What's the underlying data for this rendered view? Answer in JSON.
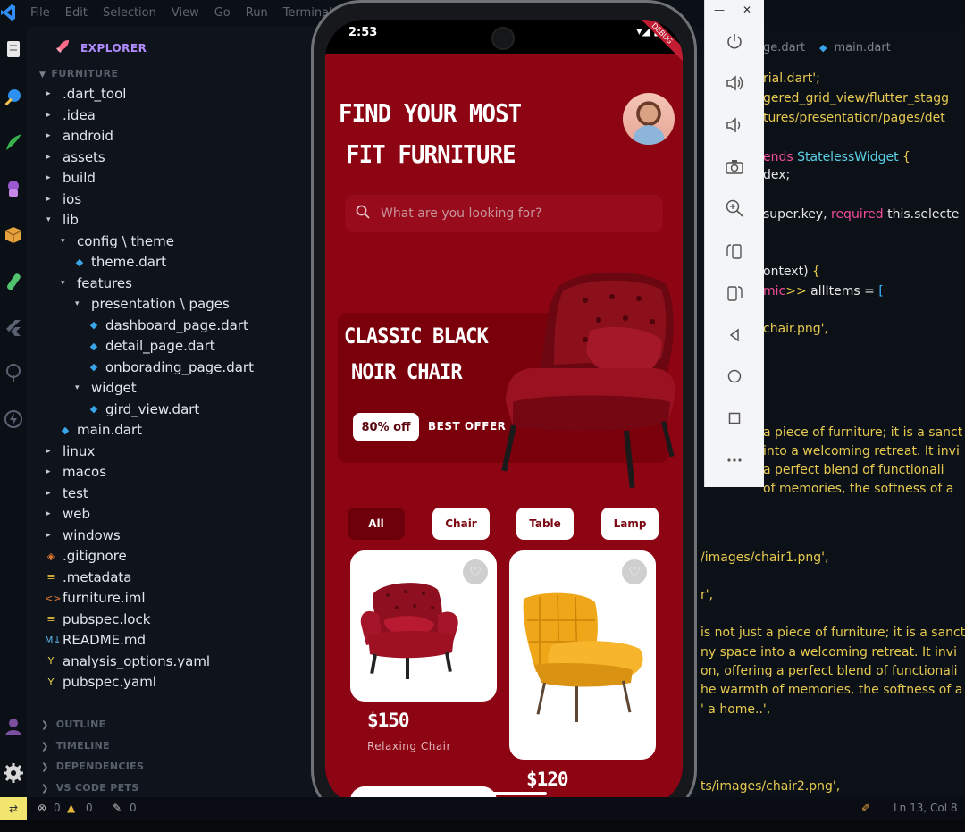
{
  "vscode": {
    "menu": [
      "File",
      "Edit",
      "Selection",
      "View",
      "Go",
      "Run",
      "Terminal"
    ],
    "explorer_title": "EXPLORER",
    "project": "FURNITURE",
    "tree": [
      {
        "label": ".dart_tool",
        "type": "folder-closed",
        "depth": 1
      },
      {
        "label": ".idea",
        "type": "folder-closed",
        "depth": 1
      },
      {
        "label": "android",
        "type": "folder-closed",
        "depth": 1
      },
      {
        "label": "assets",
        "type": "folder-closed",
        "depth": 1
      },
      {
        "label": "build",
        "type": "folder-closed",
        "depth": 1
      },
      {
        "label": "ios",
        "type": "folder-closed",
        "depth": 1
      },
      {
        "label": "lib",
        "type": "folder-open",
        "depth": 1
      },
      {
        "label": "config \\ theme",
        "type": "folder-open",
        "depth": 2
      },
      {
        "label": "theme.dart",
        "type": "dart",
        "depth": 3
      },
      {
        "label": "features",
        "type": "folder-open",
        "depth": 2
      },
      {
        "label": "presentation \\ pages",
        "type": "folder-open",
        "depth": 3
      },
      {
        "label": "dashboard_page.dart",
        "type": "dart",
        "depth": 4
      },
      {
        "label": "detail_page.dart",
        "type": "dart",
        "depth": 4
      },
      {
        "label": "onborading_page.dart",
        "type": "dart",
        "depth": 4
      },
      {
        "label": "widget",
        "type": "folder-open",
        "depth": 3
      },
      {
        "label": "gird_view.dart",
        "type": "dart",
        "depth": 4
      },
      {
        "label": "main.dart",
        "type": "dart",
        "depth": 2
      },
      {
        "label": "linux",
        "type": "folder-closed",
        "depth": 1
      },
      {
        "label": "macos",
        "type": "folder-closed",
        "depth": 1
      },
      {
        "label": "test",
        "type": "folder-closed",
        "depth": 1
      },
      {
        "label": "web",
        "type": "folder-closed",
        "depth": 1
      },
      {
        "label": "windows",
        "type": "folder-closed",
        "depth": 1
      },
      {
        "label": ".gitignore",
        "type": "git",
        "depth": 1
      },
      {
        "label": ".metadata",
        "type": "meta",
        "depth": 1
      },
      {
        "label": "furniture.iml",
        "type": "xml",
        "depth": 1
      },
      {
        "label": "pubspec.lock",
        "type": "meta",
        "depth": 1
      },
      {
        "label": "README.md",
        "type": "md",
        "depth": 1
      },
      {
        "label": "analysis_options.yaml",
        "type": "yaml",
        "depth": 1
      },
      {
        "label": "pubspec.yaml",
        "type": "yaml",
        "depth": 1
      }
    ],
    "bottom_sections": [
      "OUTLINE",
      "TIMELINE",
      "DEPENDENCIES",
      "VS CODE PETS"
    ],
    "status": {
      "errors": "0",
      "warnings": "0",
      "ports": "0",
      "cursor": "Ln 13, Col 8"
    },
    "tabs": [
      "ge.dart",
      "main.dart"
    ]
  },
  "code_lines": [
    {
      "parts": [
        [
          "y",
          "rial.dart';"
        ]
      ]
    },
    {
      "parts": [
        [
          "y",
          "gered_grid_view/flutter_stagg"
        ]
      ]
    },
    {
      "parts": [
        [
          "y",
          "tures/presentation/pages/det"
        ]
      ]
    },
    {
      "parts": [
        [
          "p",
          "ends "
        ],
        [
          "c",
          "StatelessWidget "
        ],
        [
          "y",
          "{"
        ]
      ]
    },
    {
      "parts": [
        [
          "w",
          "dex;"
        ]
      ]
    },
    {
      "parts": [
        [
          "w",
          "super.key, "
        ],
        [
          "p",
          "required "
        ],
        [
          "w",
          "this.selecte"
        ]
      ]
    },
    {
      "parts": [
        [
          "w",
          "ontext) "
        ],
        [
          "y",
          "{"
        ]
      ]
    },
    {
      "parts": [
        [
          "p",
          "mic"
        ],
        [
          "y",
          ">> "
        ],
        [
          "w",
          "allItems = "
        ],
        [
          "b",
          "["
        ]
      ]
    },
    {
      "parts": [
        [
          "y",
          "chair.png',"
        ]
      ]
    },
    {
      "parts": [
        [
          "y",
          "a piece of furniture; it is a sanct"
        ]
      ]
    },
    {
      "parts": [
        [
          "y",
          "into a welcoming retreat. It invi"
        ]
      ]
    },
    {
      "parts": [
        [
          "y",
          "a perfect blend of functionali"
        ]
      ]
    },
    {
      "parts": [
        [
          "y",
          "of memories, the softness of a"
        ]
      ]
    },
    {
      "parts": [
        [
          "y",
          "/images/chair1.png',"
        ]
      ]
    },
    {
      "parts": [
        [
          "y",
          "r',"
        ]
      ]
    },
    {
      "parts": [
        [
          "y",
          "is not just a piece of furniture; it is a sanct"
        ]
      ]
    },
    {
      "parts": [
        [
          "y",
          "ny space into a welcoming retreat. It invi"
        ]
      ]
    },
    {
      "parts": [
        [
          "y",
          "on, offering a perfect blend of functionali"
        ]
      ]
    },
    {
      "parts": [
        [
          "y",
          "he warmth of memories, the softness of a"
        ]
      ]
    },
    {
      "parts": [
        [
          "y",
          "' a home..',"
        ]
      ]
    },
    {
      "parts": [
        [
          "y",
          "ts/images/chair2.png',"
        ]
      ]
    }
  ],
  "phone": {
    "time": "2:53",
    "debug": "DEBUG",
    "headline1": "FIND YOUR MOST",
    "headline2": "FIT FURNITURE",
    "search_placeholder": "What are you looking for?",
    "banner_line1": "CLASSIC BLACK",
    "banner_line2": "NOIR CHAIR",
    "offer": "80% off",
    "best": "BEST OFFER",
    "categories": [
      "All",
      "Chair",
      "Table",
      "Lamp"
    ],
    "active_category": "All",
    "products": [
      {
        "price": "$150",
        "name": "Relaxing Chair",
        "color": "#a5132a"
      },
      {
        "price": "$120",
        "name": "",
        "color": "#f3b21b"
      }
    ]
  },
  "colors": {
    "brand": "#8d0413",
    "banner": "#7a000b",
    "chip_active": "#6e000b"
  }
}
